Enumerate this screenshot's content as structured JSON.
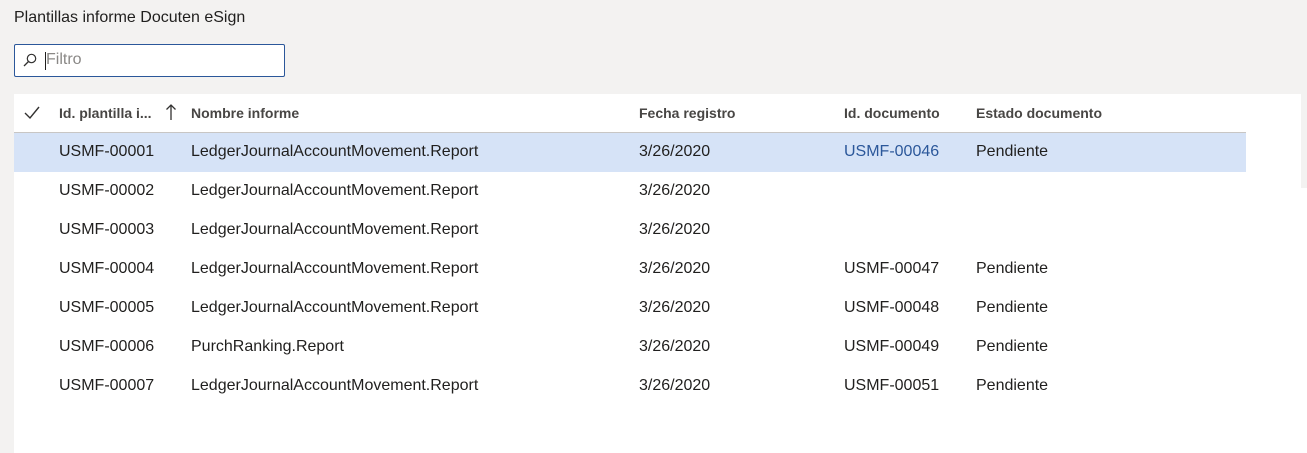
{
  "page": {
    "title": "Plantillas informe Docuten eSign"
  },
  "filter": {
    "placeholder": "Filtro",
    "value": "",
    "icon": "search-icon"
  },
  "grid": {
    "columns": {
      "id": "Id. plantilla i...",
      "name": "Nombre informe",
      "date": "Fecha registro",
      "doc": "Id. documento",
      "state": "Estado documento"
    },
    "sort": {
      "column": "id",
      "direction": "ascending"
    },
    "selected_row": 0,
    "rows": [
      {
        "id": "USMF-00001",
        "name": "LedgerJournalAccountMovement.Report",
        "date": "3/26/2020",
        "doc": "USMF-00046",
        "state": "Pendiente"
      },
      {
        "id": "USMF-00002",
        "name": "LedgerJournalAccountMovement.Report",
        "date": "3/26/2020",
        "doc": "",
        "state": ""
      },
      {
        "id": "USMF-00003",
        "name": "LedgerJournalAccountMovement.Report",
        "date": "3/26/2020",
        "doc": "",
        "state": ""
      },
      {
        "id": "USMF-00004",
        "name": "LedgerJournalAccountMovement.Report",
        "date": "3/26/2020",
        "doc": "USMF-00047",
        "state": "Pendiente"
      },
      {
        "id": "USMF-00005",
        "name": "LedgerJournalAccountMovement.Report",
        "date": "3/26/2020",
        "doc": "USMF-00048",
        "state": "Pendiente"
      },
      {
        "id": "USMF-00006",
        "name": "PurchRanking.Report",
        "date": "3/26/2020",
        "doc": "USMF-00049",
        "state": "Pendiente"
      },
      {
        "id": "USMF-00007",
        "name": "LedgerJournalAccountMovement.Report",
        "date": "3/26/2020",
        "doc": "USMF-00051",
        "state": "Pendiente"
      }
    ]
  },
  "colors": {
    "accent": "#2b579a",
    "selected_row": "#d6e3f7",
    "background": "#f3f2f1"
  }
}
